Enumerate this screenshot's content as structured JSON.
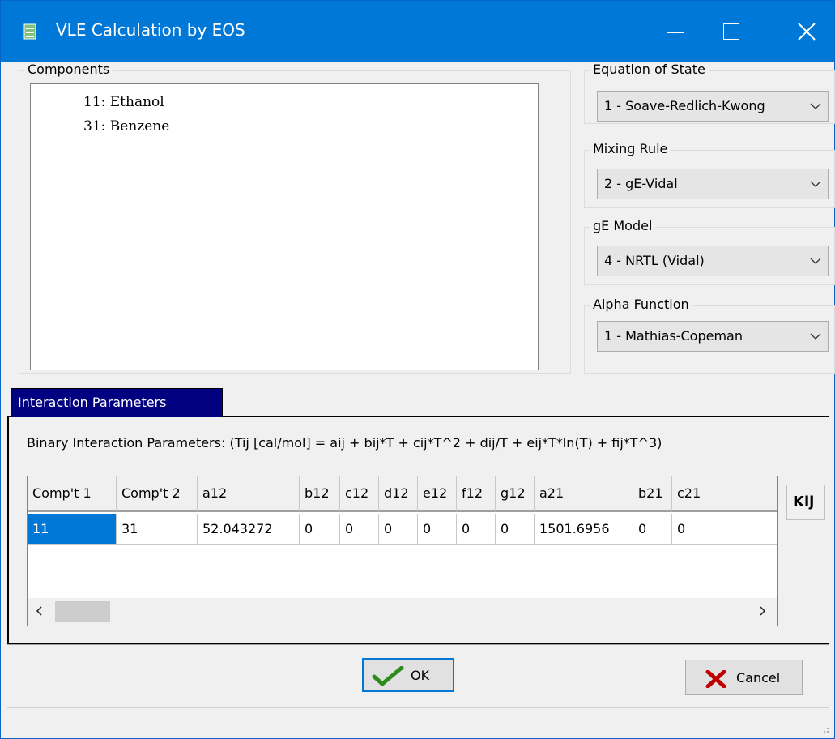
{
  "window": {
    "title": "VLE Calculation by EOS"
  },
  "components": {
    "label": "Components",
    "items": [
      "11: Ethanol",
      "31: Benzene"
    ]
  },
  "eos": {
    "label": "Equation of State",
    "value": "1 - Soave-Redlich-Kwong"
  },
  "mixing": {
    "label": "Mixing Rule",
    "value": "2 - gE-Vidal"
  },
  "ge": {
    "label": "gE Model",
    "value": "4 - NRTL (Vidal)"
  },
  "alpha": {
    "label": "Alpha Function",
    "value": "1 - Mathias-Copeman"
  },
  "tab": {
    "label": "Interaction Parameters"
  },
  "formula": "Binary Interaction Parameters: (Tij [cal/mol] = aij + bij*T + cij*T^2 + dij/T + eij*T*ln(T) + fij*T^3)",
  "grid": {
    "columns": [
      "Comp't 1",
      "Comp't 2",
      "a12",
      "b12",
      "c12",
      "d12",
      "e12",
      "f12",
      "g12",
      "a21",
      "b21",
      "c21"
    ],
    "rows": [
      [
        "11",
        "31",
        "52.043272",
        "0",
        "0",
        "0",
        "0",
        "0",
        "0",
        "1501.6956",
        "0",
        "0"
      ]
    ]
  },
  "kij_label": "Kij",
  "buttons": {
    "ok": "OK",
    "cancel": "Cancel"
  },
  "colors": {
    "titlebar": "#0078d7",
    "tab": "#000080",
    "selection": "#0078d7"
  }
}
